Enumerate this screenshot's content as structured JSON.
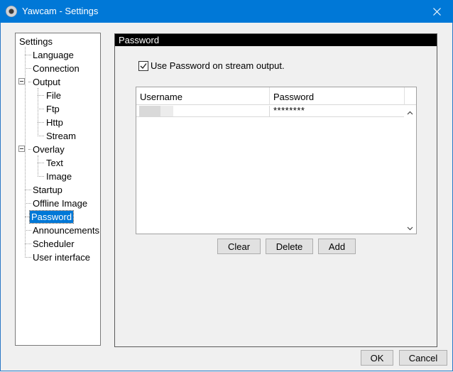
{
  "window": {
    "title": "Yawcam - Settings"
  },
  "tree": {
    "items": [
      {
        "label": "Settings"
      },
      {
        "label": "Language"
      },
      {
        "label": "Connection"
      },
      {
        "label": "Output"
      },
      {
        "label": "File"
      },
      {
        "label": "Ftp"
      },
      {
        "label": "Http"
      },
      {
        "label": "Stream"
      },
      {
        "label": "Overlay"
      },
      {
        "label": "Text"
      },
      {
        "label": "Image"
      },
      {
        "label": "Startup"
      },
      {
        "label": "Offline Image"
      },
      {
        "label": "Password",
        "selected": true
      },
      {
        "label": "Announcements"
      },
      {
        "label": "Scheduler"
      },
      {
        "label": "User interface"
      }
    ]
  },
  "panel": {
    "header": "Password",
    "use_password_label": "Use Password on stream output.",
    "use_password_checked": true,
    "table": {
      "columns": [
        "Username",
        "Password"
      ],
      "rows": [
        {
          "username": "",
          "password": "********"
        }
      ]
    },
    "buttons": {
      "clear": "Clear",
      "delete": "Delete",
      "add": "Add"
    }
  },
  "footer": {
    "ok": "OK",
    "cancel": "Cancel"
  },
  "colors": {
    "titlebar": "#0078d7",
    "selection": "#0078d7",
    "panel_header": "#000000"
  }
}
